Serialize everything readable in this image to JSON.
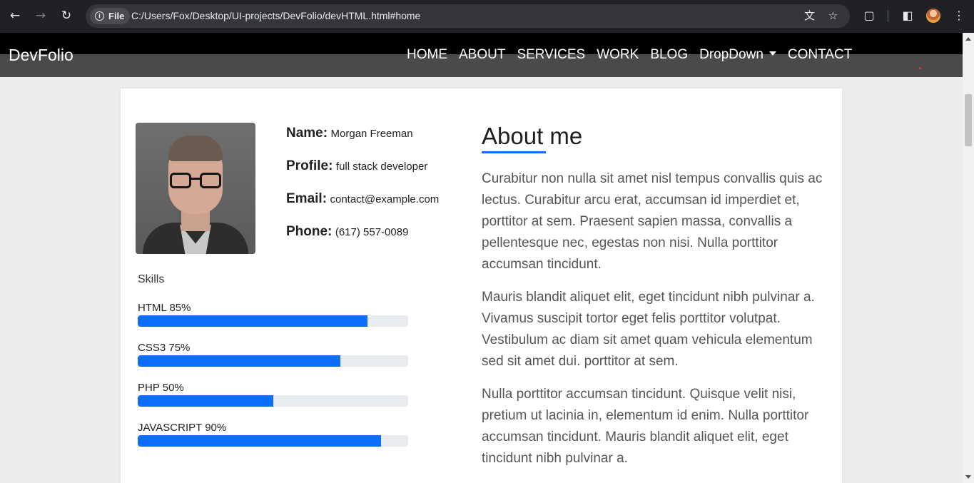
{
  "browser": {
    "file_label": "File",
    "url": "C:/Users/Fox/Desktop/UI-projects/DevFolio/devHTML.html#home"
  },
  "nav": {
    "brand": "DevFolio",
    "links": [
      "HOME",
      "ABOUT",
      "SERVICES",
      "WORK",
      "BLOG",
      "DropDown",
      "CONTACT"
    ]
  },
  "profile": {
    "name_label": "Name:",
    "name": "Morgan Freeman",
    "profile_label": "Profile:",
    "profile": "full stack developer",
    "email_label": "Email:",
    "email": "contact@example.com",
    "phone_label": "Phone:",
    "phone": "(617) 557-0089"
  },
  "skills": {
    "title": "Skills",
    "items": [
      {
        "label": "HTML 85%",
        "percent": 85
      },
      {
        "label": "CSS3 75%",
        "percent": 75
      },
      {
        "label": "PHP 50%",
        "percent": 50
      },
      {
        "label": "JAVASCRIPT 90%",
        "percent": 90
      }
    ]
  },
  "about": {
    "title": "About me",
    "paragraphs": [
      "Curabitur non nulla sit amet nisl tempus convallis quis ac lectus. Curabitur arcu erat, accumsan id imperdiet et, porttitor at sem. Praesent sapien massa, convallis a pellentesque nec, egestas non nisi. Nulla porttitor accumsan tincidunt.",
      "Mauris blandit aliquet elit, eget tincidunt nibh pulvinar a. Vivamus suscipit tortor eget felis porttitor volutpat. Vestibulum ac diam sit amet quam vehicula elementum sed sit amet dui. porttitor at sem.",
      "Nulla porttitor accumsan tincidunt. Quisque velit nisi, pretium ut lacinia in, elementum id enim. Nulla porttitor accumsan tincidunt. Mauris blandit aliquet elit, eget tincidunt nibh pulvinar a."
    ]
  },
  "colors": {
    "accent": "#0d6efd",
    "nav_bg": "#4a4a4a",
    "chrome_bg": "#202124"
  }
}
